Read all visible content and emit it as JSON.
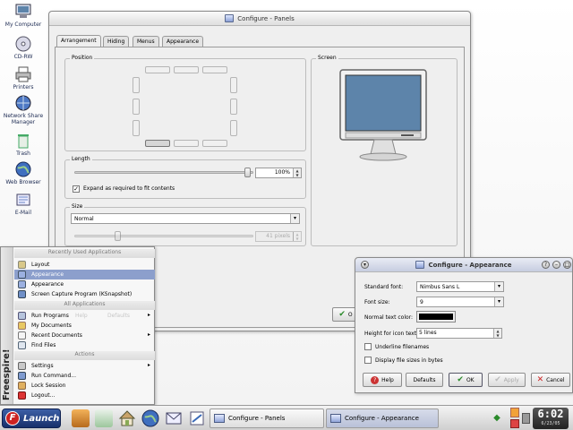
{
  "desktop": {
    "icons": [
      {
        "label": "My Computer",
        "icon": "monitor-icon"
      },
      {
        "label": "CD-RW",
        "icon": "cd-icon"
      },
      {
        "label": "Printers",
        "icon": "printer-icon"
      },
      {
        "label": "Network Share\nManager",
        "icon": "network-icon"
      },
      {
        "label": "Trash",
        "icon": "trash-icon"
      },
      {
        "label": "Web Browser",
        "icon": "globe-icon"
      },
      {
        "label": "E-Mail",
        "icon": "mail-icon"
      }
    ]
  },
  "panels_window": {
    "title": "Configure - Panels",
    "tabs": [
      "Arrangement",
      "Hiding",
      "Menus",
      "Appearance"
    ],
    "selected_tab": "Arrangement",
    "position_group": "Position",
    "screen_group": "Screen",
    "length_group": "Length",
    "length_value": "100%",
    "expand_label": "Expand as required to fit contents",
    "expand_checked": true,
    "size_group": "Size",
    "size_value": "Normal",
    "pixels_value": "41 pixels",
    "ok_partial": "O"
  },
  "appearance_window": {
    "title": "Configure - Appearance",
    "standard_font_label": "Standard font:",
    "standard_font_value": "Nimbus Sans L",
    "font_size_label": "Font size:",
    "font_size_value": "9",
    "normal_text_color_label": "Normal text color:",
    "normal_text_color": "#000000",
    "icon_text_height_label": "Height for icon text:",
    "icon_text_height_value": "5 lines",
    "underline_label": "Underline filenames",
    "underline_checked": false,
    "display_sizes_label": "Display file sizes in bytes",
    "display_sizes_checked": false,
    "buttons": {
      "help": "Help",
      "defaults": "Defaults",
      "ok": "OK",
      "apply": "Apply",
      "cancel": "Cancel"
    }
  },
  "launch_menu": {
    "side_label": "Freespire!",
    "recent_header": "Recently Used Applications",
    "recent_items": [
      {
        "label": "Layout",
        "highlighted": false
      },
      {
        "label": "Appearance",
        "highlighted": true
      },
      {
        "label": "Appearance",
        "highlighted": false
      },
      {
        "label": "Screen Capture Program (KSnapshot)",
        "highlighted": false
      }
    ],
    "all_header": "All Applications",
    "all_items": [
      {
        "label": "Run Programs",
        "submenu": true
      },
      {
        "label": "My Documents",
        "submenu": false
      },
      {
        "label": "Recent Documents",
        "submenu": true
      },
      {
        "label": "Find Files",
        "submenu": false
      }
    ],
    "actions_header": "Actions",
    "action_items": [
      {
        "label": "Settings",
        "submenu": true
      },
      {
        "label": "Run Command...",
        "submenu": false
      },
      {
        "label": "Lock Session",
        "submenu": false
      },
      {
        "label": "Logout...",
        "submenu": false
      }
    ],
    "ghost_help": "Help",
    "ghost_defaults": "Defaults"
  },
  "taskbar": {
    "launch_label": "Launch",
    "tasks": [
      {
        "label": "Configure - Panels",
        "active": false
      },
      {
        "label": "Configure - Appearance",
        "active": true
      }
    ],
    "clock_time": "6:02",
    "clock_date": "6/23/05"
  },
  "colors": {
    "highlight": "#8c9fcc",
    "launch_blue": "#17306b",
    "screen_blue": "#5d84aa"
  }
}
